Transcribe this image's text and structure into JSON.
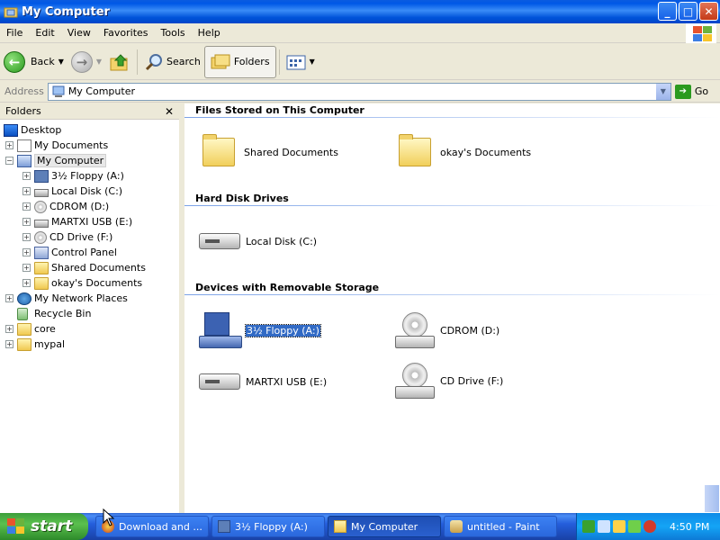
{
  "window": {
    "title": "My Computer",
    "controls": {
      "minimize": "_",
      "maximize": "□",
      "close": "✕"
    }
  },
  "menu": [
    "File",
    "Edit",
    "View",
    "Favorites",
    "Tools",
    "Help"
  ],
  "toolbar": {
    "back_label": "Back",
    "search_label": "Search",
    "folders_label": "Folders"
  },
  "address": {
    "label": "Address",
    "value": "My Computer",
    "go_label": "Go"
  },
  "folders_pane": {
    "title": "Folders",
    "close": "✕",
    "tree": [
      {
        "label": "Desktop",
        "icon": "desktop-icon"
      },
      {
        "label": "My Documents",
        "icon": "documents-icon"
      },
      {
        "label": "My Computer",
        "icon": "computer-icon"
      },
      {
        "label": "3½ Floppy (A:)",
        "icon": "floppy-icon"
      },
      {
        "label": "Local Disk (C:)",
        "icon": "hard-drive-icon"
      },
      {
        "label": "CDROM (D:)",
        "icon": "cd-drive-icon"
      },
      {
        "label": "MARTXI USB (E:)",
        "icon": "usb-drive-icon"
      },
      {
        "label": "CD Drive (F:)",
        "icon": "cd-drive-icon"
      },
      {
        "label": "Control Panel",
        "icon": "control-panel-icon"
      },
      {
        "label": "Shared Documents",
        "icon": "folder-icon"
      },
      {
        "label": "okay's Documents",
        "icon": "folder-icon"
      },
      {
        "label": "My Network Places",
        "icon": "network-icon"
      },
      {
        "label": "Recycle Bin",
        "icon": "recycle-bin-icon"
      },
      {
        "label": "core",
        "icon": "folder-icon"
      },
      {
        "label": "mypal",
        "icon": "folder-icon"
      }
    ]
  },
  "content": {
    "groups": [
      {
        "title": "Files Stored on This Computer",
        "items": [
          "Shared Documents",
          "okay's Documents"
        ]
      },
      {
        "title": "Hard Disk Drives",
        "items": [
          "Local Disk (C:)"
        ]
      },
      {
        "title": "Devices with Removable Storage",
        "items": [
          "3½ Floppy (A:)",
          "CDROM (D:)",
          "MARTXI USB (E:)",
          "CD Drive (F:)"
        ]
      }
    ],
    "selected_item": "3½ Floppy (A:)"
  },
  "taskbar": {
    "start_label": "start",
    "tasks": [
      {
        "label": "Download and ...",
        "icon": "browser-icon"
      },
      {
        "label": "3½ Floppy (A:)",
        "icon": "floppy-icon"
      },
      {
        "label": "My Computer",
        "icon": "folder-icon",
        "active": true
      },
      {
        "label": "untitled - Paint",
        "icon": "paint-icon"
      }
    ],
    "clock": "4:50 PM"
  },
  "colors": {
    "titlebar": "#0058e6",
    "selection": "#316ac5",
    "group_line": "#7ba2e7",
    "start_green": "#3c9e3a"
  }
}
